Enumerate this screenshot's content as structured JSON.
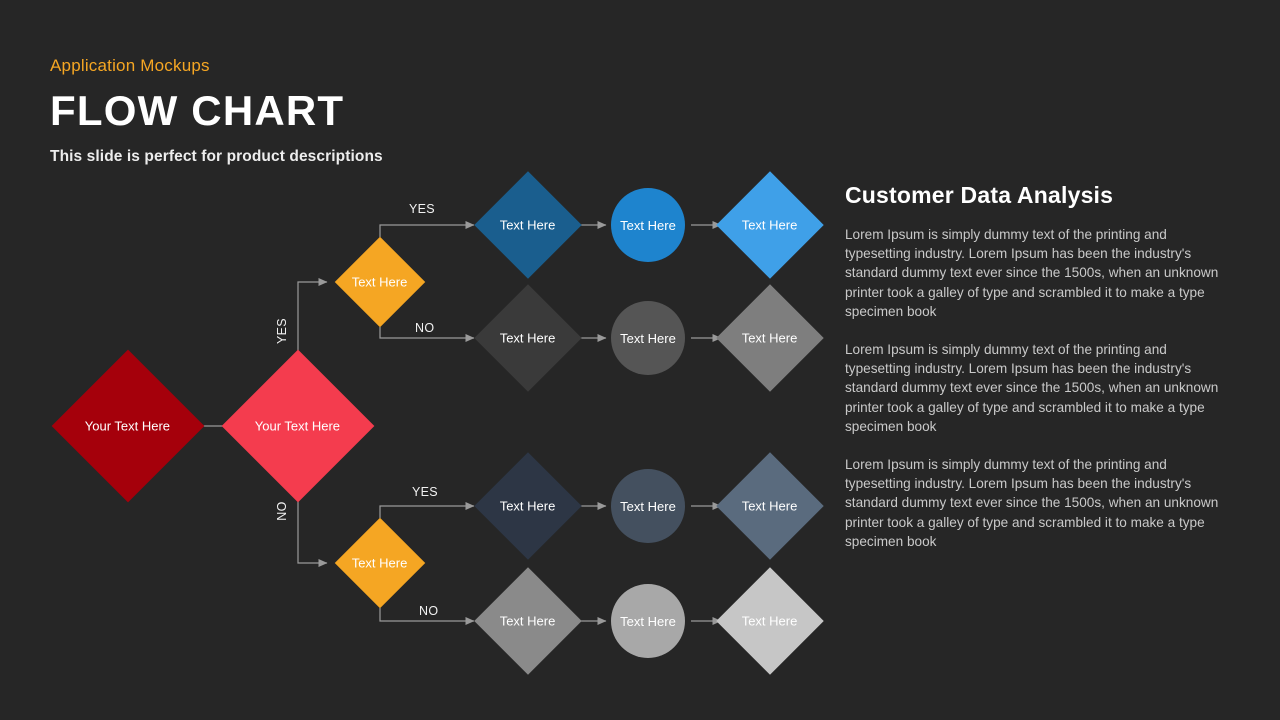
{
  "header": {
    "eyebrow": "Application Mockups",
    "title": "FLOW CHART",
    "subtitle": "This slide is perfect for product descriptions"
  },
  "panel": {
    "heading": "Customer Data Analysis",
    "paragraphs": [
      "Lorem Ipsum is simply dummy text of the printing and typesetting industry. Lorem Ipsum has been the industry's standard dummy text ever since the 1500s, when an unknown printer took a galley of type and scrambled it to make a type specimen book",
      "Lorem Ipsum is simply dummy text of the printing and typesetting industry. Lorem Ipsum has been the industry's standard dummy text ever since the 1500s, when an unknown printer took a galley of type and scrambled it to make a type specimen book",
      "Lorem Ipsum is simply dummy text of the printing and typesetting industry. Lorem Ipsum has been the industry's standard dummy text ever since the 1500s, when an unknown printer took a galley of type and scrambled it to make a type specimen book"
    ]
  },
  "colors": {
    "background": "#262626",
    "accent": "#F5A623",
    "start_dark_red": "#A5000B",
    "decision_red": "#F43C4E",
    "branch_orange": "#F5A623",
    "blue_dark": "#1A5E8E",
    "blue_mid": "#1E84CE",
    "blue_light": "#3FA0E8",
    "gray_dark": "#3A3A3A",
    "gray_mid": "#555555",
    "gray_light": "#7E7E7E",
    "slate_dark": "#2D3645",
    "slate_mid": "#44505F",
    "slate_light": "#5A6B7E",
    "ltgray_dark": "#8A8A8A",
    "ltgray_mid": "#A8A8A8",
    "ltgray_light": "#C6C6C6",
    "connector": "#9A9A9A",
    "text_on_shape": "#FFFFFF",
    "paragraph_text": "#C9C9C9"
  },
  "flow": {
    "start": {
      "label": "Your Text Here"
    },
    "decision": {
      "label": "Your Text Here"
    },
    "branch_top": {
      "label": "Text Here"
    },
    "branch_bottom": {
      "label": "Text Here"
    },
    "edge_labels": {
      "trunk_yes": "YES",
      "trunk_no": "NO",
      "top_yes": "YES",
      "top_no": "NO",
      "bottom_yes": "YES",
      "bottom_no": "NO"
    },
    "rows": [
      {
        "name": "row-blue",
        "nodes": [
          {
            "label": "Text Here"
          },
          {
            "label": "Text Here"
          },
          {
            "label": "Text Here"
          }
        ]
      },
      {
        "name": "row-gray",
        "nodes": [
          {
            "label": "Text Here"
          },
          {
            "label": "Text Here"
          },
          {
            "label": "Text Here"
          }
        ]
      },
      {
        "name": "row-slate",
        "nodes": [
          {
            "label": "Text Here"
          },
          {
            "label": "Text Here"
          },
          {
            "label": "Text Here"
          }
        ]
      },
      {
        "name": "row-ltgray",
        "nodes": [
          {
            "label": "Text Here"
          },
          {
            "label": "Text Here"
          },
          {
            "label": "Text Here"
          }
        ]
      }
    ]
  }
}
